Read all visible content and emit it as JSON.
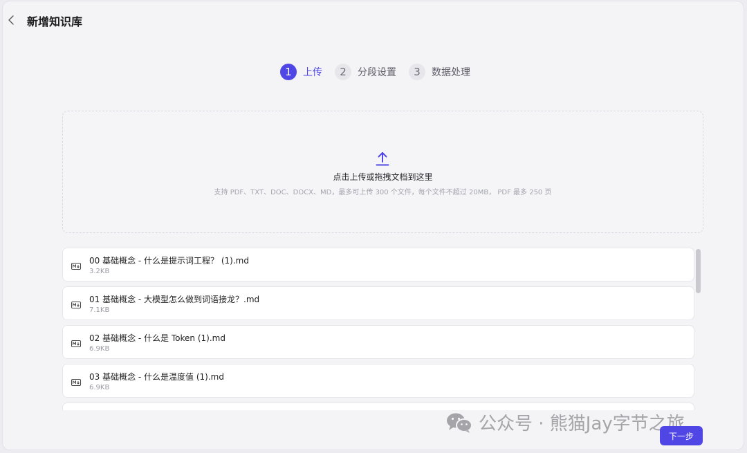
{
  "header": {
    "title": "新增知识库"
  },
  "steps": [
    {
      "num": "1",
      "label": "上传",
      "active": true
    },
    {
      "num": "2",
      "label": "分段设置",
      "active": false
    },
    {
      "num": "3",
      "label": "数据处理",
      "active": false
    }
  ],
  "dropzone": {
    "main_text": "点击上传或拖拽文档到这里",
    "hint_text": "支持 PDF、TXT、DOC、DOCX、MD，最多可上传 300 个文件，每个文件不超过 20MB， PDF 最多 250 页"
  },
  "files": [
    {
      "name": "00 基础概念 - 什么是提示词工程？ (1).md",
      "size": "3.2KB"
    },
    {
      "name": "01 基础概念 - 大模型怎么做到词语接龙？.md",
      "size": "7.1KB"
    },
    {
      "name": "02 基础概念 - 什么是 Token (1).md",
      "size": "6.9KB"
    },
    {
      "name": "03 基础概念 - 什么是温度值 (1).md",
      "size": "6.9KB"
    }
  ],
  "footer": {
    "next_label": "下一步"
  },
  "watermark": {
    "text": "公众号 · 熊猫Jay字节之旅"
  },
  "colors": {
    "accent": "#4f46e5",
    "background": "#f4f4f7"
  },
  "icons": {
    "back": "chevron-left-icon",
    "upload": "upload-icon",
    "file": "markdown-file-icon",
    "wechat": "wechat-icon"
  }
}
